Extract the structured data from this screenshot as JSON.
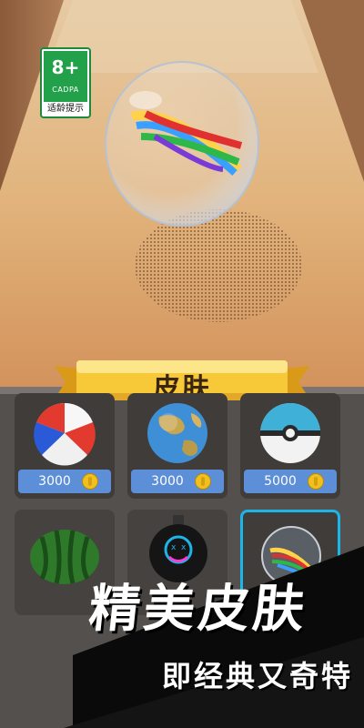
{
  "rating": {
    "age": "8+",
    "org": "CADPA",
    "tip": "适龄提示"
  },
  "shop": {
    "title": "皮肤",
    "items": [
      {
        "name": "beach-ball",
        "price": "3000"
      },
      {
        "name": "globe-ball",
        "price": "3000"
      },
      {
        "name": "pokeball",
        "price": "5000"
      },
      {
        "name": "watermelon-ball",
        "price": ""
      },
      {
        "name": "bomb-ball",
        "price": ""
      },
      {
        "name": "glass-ribbon-ball",
        "price": "",
        "selected": true
      }
    ]
  },
  "promo": {
    "line1": "精美皮肤",
    "line2": "即经典又奇特"
  },
  "colors": {
    "badge_green": "#22a04a",
    "price_blue": "#5c8fd8",
    "select_border": "#1db4e8",
    "coin": "#f0c020",
    "panel": "#54504d"
  }
}
